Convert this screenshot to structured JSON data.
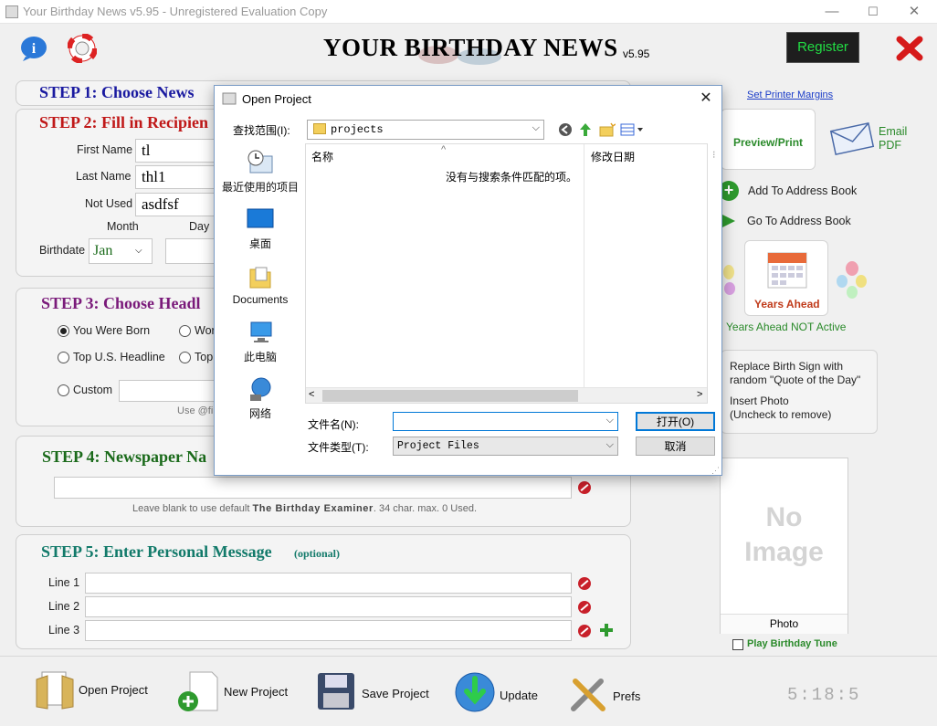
{
  "window": {
    "title": "Your Birthday News v5.95 - Unregistered Evaluation Copy",
    "min": "—",
    "max": "☐",
    "close": "✕"
  },
  "header": {
    "logo_text": "YOUR BIRTHDAY NEWS",
    "version": "v5.95",
    "register_label": "Register"
  },
  "step1": {
    "title": "STEP 1: Choose News"
  },
  "step2": {
    "title": "STEP 2: Fill in Recipien",
    "first_name_label": "First Name",
    "first_name_value": "tl",
    "last_name_label": "Last Name",
    "last_name_value": "thl1",
    "not_used_label": "Not Used",
    "not_used_value": "asdfsf",
    "month_label": "Month",
    "day_label": "Day",
    "birthdate_label": "Birthdate",
    "month_value": "Jan"
  },
  "step3": {
    "title": "STEP 3: Choose Headl",
    "opt_you_were_born": "You Were Born",
    "opt_wor": "Wor",
    "opt_top_us": "Top U.S. Headline",
    "opt_top": "Top",
    "opt_custom": "Custom",
    "hint": "Use @fi"
  },
  "step4": {
    "title": "STEP 4: Newspaper Na",
    "hint_prefix": "Leave blank to use default ",
    "hint_bold": "The Birthday Examiner",
    "hint_suffix": ". 34 char. max. 0 Used."
  },
  "step5": {
    "title": "STEP 5: Enter Personal Message",
    "optional": "(optional)",
    "line1": "Line 1",
    "line2": "Line 2",
    "line3": "Line 3"
  },
  "right_panel": {
    "set_printer_margins": "Set Printer Margins",
    "preview_print": "Preview/Print",
    "email_pdf_1": "Email",
    "email_pdf_2": "PDF",
    "add_to_address_book": "Add To Address Book",
    "go_to_address_book": "Go To Address Book",
    "years_ahead": "Years Ahead",
    "years_ahead_status": "Years Ahead NOT Active",
    "replace_birth_sign_1": "Replace Birth Sign with",
    "replace_birth_sign_2": "random \"Quote of the Day\"",
    "insert_photo_1": "Insert Photo",
    "insert_photo_2": "(Uncheck to remove)",
    "no_image_1": "No",
    "no_image_2": "Image",
    "photo_label": "Photo",
    "play_birthday_tune": "Play Birthday Tune"
  },
  "bottom_bar": {
    "open_project": "Open Project",
    "new_project": "New Project",
    "save_project": "Save Project",
    "update": "Update",
    "prefs": "Prefs",
    "clock": "5:18:5"
  },
  "dialog": {
    "title": "Open Project",
    "look_in_label": "查找范围(I):",
    "look_in_value": "projects",
    "places": [
      "最近使用的项目",
      "桌面",
      "Documents",
      "此电脑",
      "网络"
    ],
    "col_name": "名称",
    "col_date": "修改日期",
    "empty_message": "没有与搜索条件匹配的项。",
    "filename_label": "文件名(N):",
    "filename_value": "",
    "filetype_label": "文件类型(T):",
    "filetype_value": "Project Files",
    "open_label": "打开(O)",
    "cancel_label": "取消"
  },
  "colors": {
    "step1": "#1a1aa0",
    "step2": "#c01818",
    "step3": "#7a1a7a",
    "step4": "#1a6a1a",
    "step5": "#127a6a",
    "register_bg": "#1e1e1e",
    "register_text": "#22dd44",
    "link_blue": "#1a3cc8",
    "green_text": "#2a8a2a"
  }
}
